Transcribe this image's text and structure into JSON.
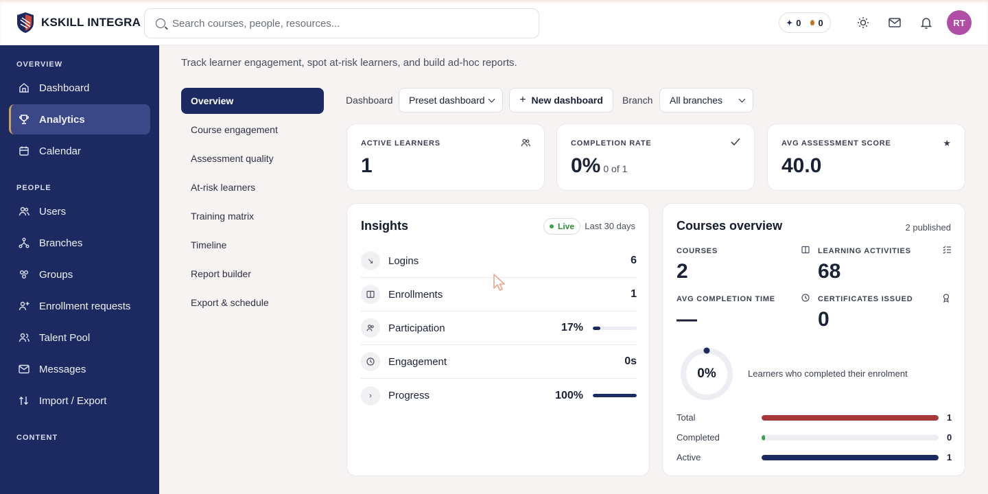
{
  "brand": {
    "name": "KSKILL INTEGRA"
  },
  "search": {
    "placeholder": "Search courses, people, resources..."
  },
  "header": {
    "sparks": "0",
    "streak": "0",
    "avatar_initials": "RT"
  },
  "sidebar": {
    "sections": [
      "OVERVIEW",
      "PEOPLE",
      "CONTENT"
    ],
    "items": [
      {
        "label": "Dashboard",
        "icon": "home-icon"
      },
      {
        "label": "Analytics",
        "icon": "trophy-icon",
        "active": true
      },
      {
        "label": "Calendar",
        "icon": "calendar-icon"
      },
      {
        "label": "Users",
        "icon": "users-icon"
      },
      {
        "label": "Branches",
        "icon": "branches-icon"
      },
      {
        "label": "Groups",
        "icon": "groups-icon"
      },
      {
        "label": "Enrollment requests",
        "icon": "user-plus-icon"
      },
      {
        "label": "Talent Pool",
        "icon": "talent-icon"
      },
      {
        "label": "Messages",
        "icon": "mail-icon"
      },
      {
        "label": "Import / Export",
        "icon": "import-export-icon"
      }
    ]
  },
  "page": {
    "subtitle": "Track learner engagement, spot at-risk learners, and build ad-hoc reports."
  },
  "subnav": [
    "Overview",
    "Course engagement",
    "Assessment quality",
    "At-risk learners",
    "Training matrix",
    "Timeline",
    "Report builder",
    "Export & schedule"
  ],
  "controls": {
    "dashboard_label": "Dashboard",
    "dashboard_value": "Preset dashboard",
    "new_dashboard": "New dashboard",
    "branch_label": "Branch",
    "branch_value": "All branches"
  },
  "kpis": [
    {
      "label": "ACTIVE LEARNERS",
      "value": "1",
      "sub": "",
      "icon": "users-icon"
    },
    {
      "label": "COMPLETION RATE",
      "value": "0%",
      "sub": "0 of 1",
      "icon": "check-icon"
    },
    {
      "label": "AVG ASSESSMENT SCORE",
      "value": "40.0",
      "sub": "",
      "icon": "star-icon"
    }
  ],
  "insights": {
    "title": "Insights",
    "live": "Live",
    "range": "Last 30 days",
    "rows": [
      {
        "label": "Logins",
        "value": "6",
        "icon": "arrow-down-right-icon"
      },
      {
        "label": "Enrollments",
        "value": "1",
        "icon": "book-icon"
      },
      {
        "label": "Participation",
        "value": "17%",
        "icon": "people-icon",
        "progress": 0.17
      },
      {
        "label": "Engagement",
        "value": "0s",
        "icon": "clock-icon"
      },
      {
        "label": "Progress",
        "value": "100%",
        "icon": "chevron-right-icon",
        "progress": 1.0
      }
    ]
  },
  "courses": {
    "title": "Courses overview",
    "published": "2 published",
    "stats": [
      {
        "label": "COURSES",
        "value": "2",
        "icon": "book-icon"
      },
      {
        "label": "LEARNING ACTIVITIES",
        "value": "68",
        "icon": "checklist-icon"
      },
      {
        "label": "AVG COMPLETION TIME",
        "value": "—",
        "icon": "clock-icon"
      },
      {
        "label": "CERTIFICATES ISSUED",
        "value": "0",
        "icon": "award-icon"
      }
    ],
    "completion_percent": "0%",
    "completion_fraction": 0,
    "completion_caption": "Learners who completed their enrolment",
    "bars": [
      {
        "label": "Total",
        "value": "1",
        "fraction": 1.0,
        "color": "#a6383a"
      },
      {
        "label": "Completed",
        "value": "0",
        "fraction": 0.02,
        "color": "#3aa34a"
      },
      {
        "label": "Active",
        "value": "1",
        "fraction": 1.0,
        "color": "#1d2a62"
      }
    ]
  },
  "colors": {
    "navy": "#1d2a62",
    "accent_gold": "#c9a25b",
    "avatar": "#b04ea6",
    "live_green": "#3aa34a"
  }
}
